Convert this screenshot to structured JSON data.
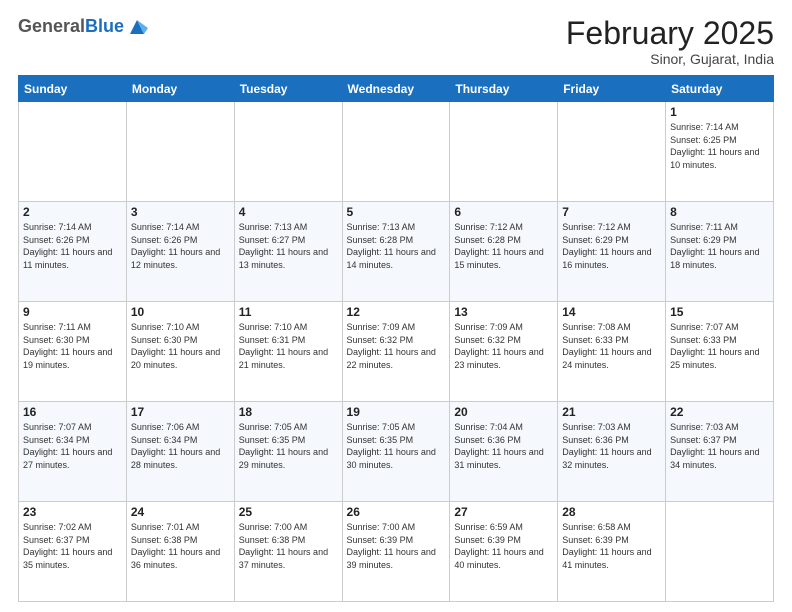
{
  "header": {
    "logo_general": "General",
    "logo_blue": "Blue",
    "month_title": "February 2025",
    "subtitle": "Sinor, Gujarat, India"
  },
  "days_of_week": [
    "Sunday",
    "Monday",
    "Tuesday",
    "Wednesday",
    "Thursday",
    "Friday",
    "Saturday"
  ],
  "weeks": [
    [
      {
        "day": "",
        "info": ""
      },
      {
        "day": "",
        "info": ""
      },
      {
        "day": "",
        "info": ""
      },
      {
        "day": "",
        "info": ""
      },
      {
        "day": "",
        "info": ""
      },
      {
        "day": "",
        "info": ""
      },
      {
        "day": "1",
        "info": "Sunrise: 7:14 AM\nSunset: 6:25 PM\nDaylight: 11 hours\nand 10 minutes."
      }
    ],
    [
      {
        "day": "2",
        "info": "Sunrise: 7:14 AM\nSunset: 6:26 PM\nDaylight: 11 hours\nand 11 minutes."
      },
      {
        "day": "3",
        "info": "Sunrise: 7:14 AM\nSunset: 6:26 PM\nDaylight: 11 hours\nand 12 minutes."
      },
      {
        "day": "4",
        "info": "Sunrise: 7:13 AM\nSunset: 6:27 PM\nDaylight: 11 hours\nand 13 minutes."
      },
      {
        "day": "5",
        "info": "Sunrise: 7:13 AM\nSunset: 6:28 PM\nDaylight: 11 hours\nand 14 minutes."
      },
      {
        "day": "6",
        "info": "Sunrise: 7:12 AM\nSunset: 6:28 PM\nDaylight: 11 hours\nand 15 minutes."
      },
      {
        "day": "7",
        "info": "Sunrise: 7:12 AM\nSunset: 6:29 PM\nDaylight: 11 hours\nand 16 minutes."
      },
      {
        "day": "8",
        "info": "Sunrise: 7:11 AM\nSunset: 6:29 PM\nDaylight: 11 hours\nand 18 minutes."
      }
    ],
    [
      {
        "day": "9",
        "info": "Sunrise: 7:11 AM\nSunset: 6:30 PM\nDaylight: 11 hours\nand 19 minutes."
      },
      {
        "day": "10",
        "info": "Sunrise: 7:10 AM\nSunset: 6:30 PM\nDaylight: 11 hours\nand 20 minutes."
      },
      {
        "day": "11",
        "info": "Sunrise: 7:10 AM\nSunset: 6:31 PM\nDaylight: 11 hours\nand 21 minutes."
      },
      {
        "day": "12",
        "info": "Sunrise: 7:09 AM\nSunset: 6:32 PM\nDaylight: 11 hours\nand 22 minutes."
      },
      {
        "day": "13",
        "info": "Sunrise: 7:09 AM\nSunset: 6:32 PM\nDaylight: 11 hours\nand 23 minutes."
      },
      {
        "day": "14",
        "info": "Sunrise: 7:08 AM\nSunset: 6:33 PM\nDaylight: 11 hours\nand 24 minutes."
      },
      {
        "day": "15",
        "info": "Sunrise: 7:07 AM\nSunset: 6:33 PM\nDaylight: 11 hours\nand 25 minutes."
      }
    ],
    [
      {
        "day": "16",
        "info": "Sunrise: 7:07 AM\nSunset: 6:34 PM\nDaylight: 11 hours\nand 27 minutes."
      },
      {
        "day": "17",
        "info": "Sunrise: 7:06 AM\nSunset: 6:34 PM\nDaylight: 11 hours\nand 28 minutes."
      },
      {
        "day": "18",
        "info": "Sunrise: 7:05 AM\nSunset: 6:35 PM\nDaylight: 11 hours\nand 29 minutes."
      },
      {
        "day": "19",
        "info": "Sunrise: 7:05 AM\nSunset: 6:35 PM\nDaylight: 11 hours\nand 30 minutes."
      },
      {
        "day": "20",
        "info": "Sunrise: 7:04 AM\nSunset: 6:36 PM\nDaylight: 11 hours\nand 31 minutes."
      },
      {
        "day": "21",
        "info": "Sunrise: 7:03 AM\nSunset: 6:36 PM\nDaylight: 11 hours\nand 32 minutes."
      },
      {
        "day": "22",
        "info": "Sunrise: 7:03 AM\nSunset: 6:37 PM\nDaylight: 11 hours\nand 34 minutes."
      }
    ],
    [
      {
        "day": "23",
        "info": "Sunrise: 7:02 AM\nSunset: 6:37 PM\nDaylight: 11 hours\nand 35 minutes."
      },
      {
        "day": "24",
        "info": "Sunrise: 7:01 AM\nSunset: 6:38 PM\nDaylight: 11 hours\nand 36 minutes."
      },
      {
        "day": "25",
        "info": "Sunrise: 7:00 AM\nSunset: 6:38 PM\nDaylight: 11 hours\nand 37 minutes."
      },
      {
        "day": "26",
        "info": "Sunrise: 7:00 AM\nSunset: 6:39 PM\nDaylight: 11 hours\nand 39 minutes."
      },
      {
        "day": "27",
        "info": "Sunrise: 6:59 AM\nSunset: 6:39 PM\nDaylight: 11 hours\nand 40 minutes."
      },
      {
        "day": "28",
        "info": "Sunrise: 6:58 AM\nSunset: 6:39 PM\nDaylight: 11 hours\nand 41 minutes."
      },
      {
        "day": "",
        "info": ""
      }
    ]
  ]
}
